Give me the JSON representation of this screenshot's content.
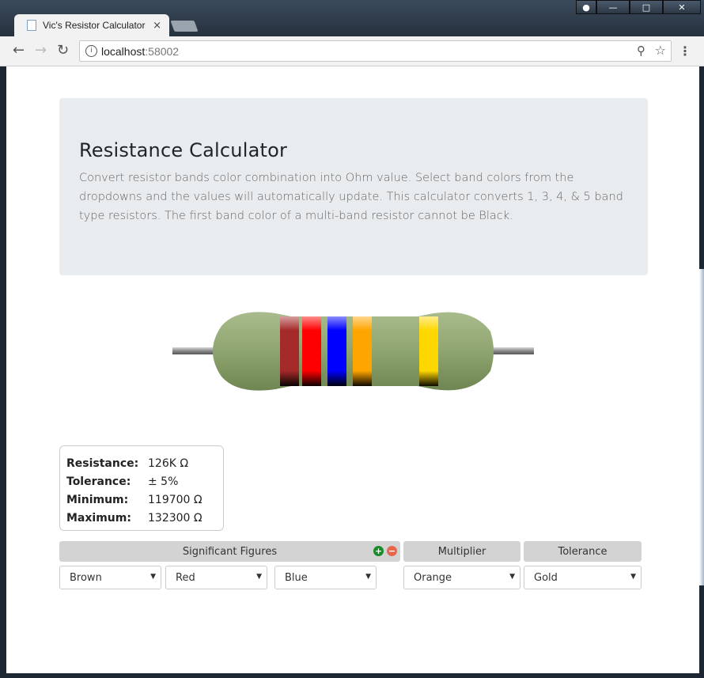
{
  "browser": {
    "tab_title": "Vic's Resistor Calculator",
    "tab_close": "×",
    "url_host": "localhost",
    "url_port": ":58002"
  },
  "page": {
    "title": "Resistance Calculator",
    "description": "Convert resistor bands color combination into Ohm value. Select band colors from the dropdowns and the values will automatically update. This calculator converts 1, 3, 4, & 5 band type resistors. The first band color of a multi-band resistor cannot be Black."
  },
  "resistor": {
    "body_color": "#8fa56f",
    "bands": [
      {
        "color": "#a52a2a"
      },
      {
        "color": "#ff0000"
      },
      {
        "color": "#0000ff"
      },
      {
        "color": "#ffa500"
      },
      {
        "color": "#ffd700"
      }
    ]
  },
  "results": {
    "resistance_label": "Resistance:",
    "resistance_value": "126K Ω",
    "tolerance_label": "Tolerance:",
    "tolerance_value": "± 5%",
    "minimum_label": "Minimum:",
    "minimum_value": "119700 Ω",
    "maximum_label": "Maximum:",
    "maximum_value": "132300 Ω"
  },
  "controls": {
    "significant_figures_label": "Significant Figures",
    "multiplier_label": "Multiplier",
    "tolerance_label": "Tolerance",
    "add_band_icon": "plus-circle-icon",
    "remove_band_icon": "minus-circle-icon",
    "band1": "Brown",
    "band2": "Red",
    "band3": "Blue",
    "multiplier": "Orange",
    "tolerance": "Gold"
  }
}
